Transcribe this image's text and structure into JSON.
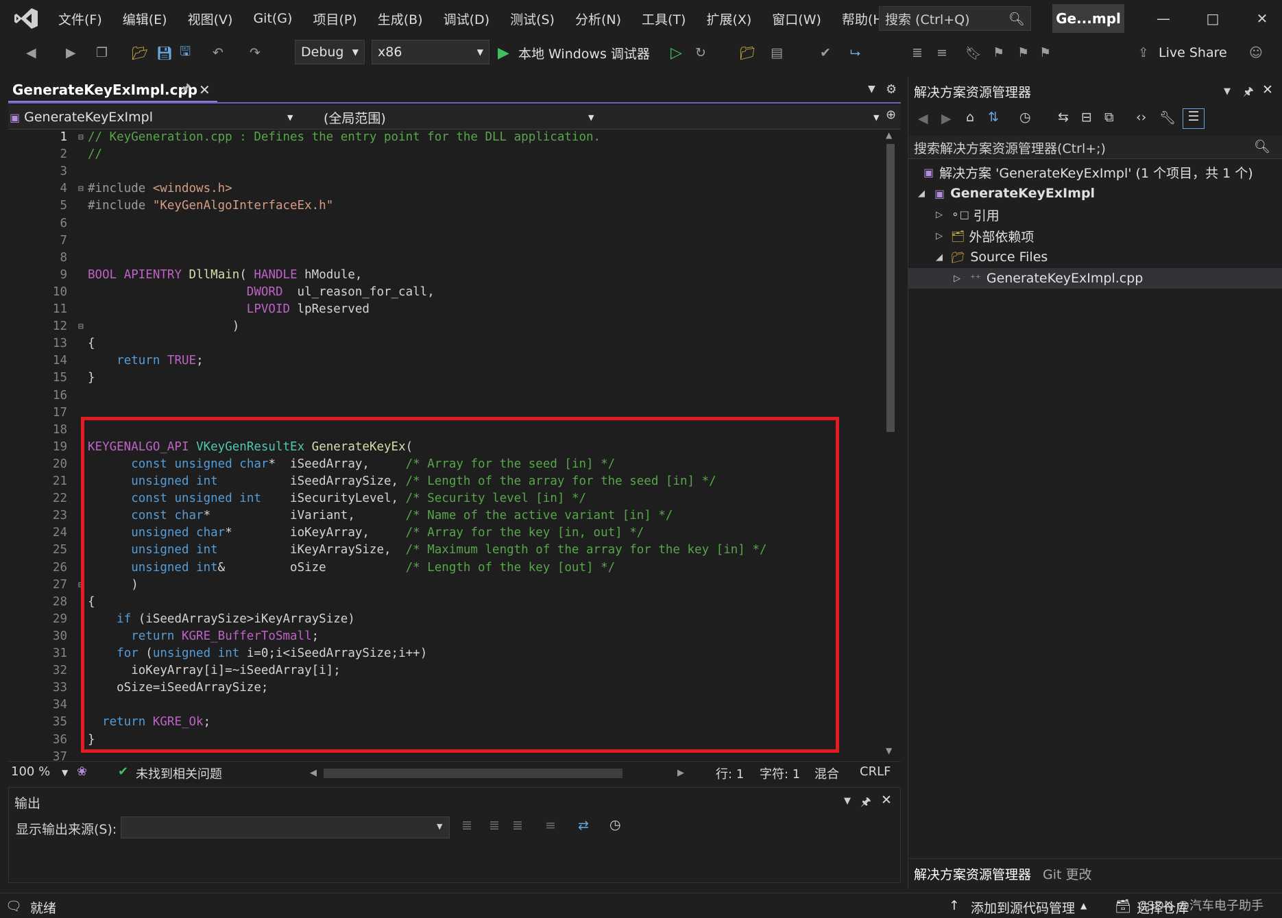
{
  "menubar": {
    "items": [
      "文件(F)",
      "编辑(E)",
      "视图(V)",
      "Git(G)",
      "项目(P)",
      "生成(B)",
      "调试(D)",
      "测试(S)",
      "分析(N)",
      "工具(T)",
      "扩展(X)",
      "窗口(W)",
      "帮助(H)"
    ],
    "search_placeholder": "搜索 (Ctrl+Q)",
    "solution_badge": "Ge...mpl"
  },
  "toolbar": {
    "config": "Debug",
    "platform": "x86",
    "run_label": "本地 Windows 调试器",
    "live_share": "Live Share"
  },
  "editor": {
    "tab_title": "GenerateKeyExImpl.cpp",
    "project_dropdown": "GenerateKeyExImpl",
    "scope_dropdown": "(全局范围)",
    "zoom": "100 %",
    "issues": "未找到相关问题",
    "line": "行: 1",
    "char": "字符: 1",
    "encoding": "混合",
    "eol": "CRLF",
    "code_lines": [
      "// KeyGeneration.cpp : Defines the entry point for the DLL application.",
      "//",
      "",
      "#include <windows.h>",
      "#include \"KeyGenAlgoInterfaceEx.h\"",
      "",
      "",
      "",
      "BOOL APIENTRY DllMain( HANDLE hModule,",
      "                      DWORD  ul_reason_for_call,",
      "                      LPVOID lpReserved",
      "                    )",
      "{",
      "    return TRUE;",
      "}",
      "",
      "",
      "",
      "KEYGENALGO_API VKeyGenResultEx GenerateKeyEx(",
      "      const unsigned char*  iSeedArray,     /* Array for the seed [in] */",
      "      unsigned int          iSeedArraySize, /* Length of the array for the seed [in] */",
      "      const unsigned int    iSecurityLevel, /* Security level [in] */",
      "      const char*           iVariant,       /* Name of the active variant [in] */",
      "      unsigned char*        ioKeyArray,     /* Array for the key [in, out] */",
      "      unsigned int          iKeyArraySize,  /* Maximum length of the array for the key [in] */",
      "      unsigned int&         oSize           /* Length of the key [out] */",
      "      )",
      "{",
      "    if (iSeedArraySize>iKeyArraySize)",
      "      return KGRE_BufferToSmall;",
      "    for (unsigned int i=0;i<iSeedArraySize;i++)",
      "      ioKeyArray[i]=~iSeedArray[i];",
      "    oSize=iSeedArraySize;",
      "",
      "  return KGRE_Ok;",
      "}",
      ""
    ]
  },
  "output": {
    "title": "输出",
    "source_label": "显示输出来源(S):"
  },
  "solution_explorer": {
    "title": "解决方案资源管理器",
    "search_placeholder": "搜索解决方案资源管理器(Ctrl+;)",
    "solution_row": "解决方案 'GenerateKeyExImpl' (1 个项目，共 1 个)",
    "project": "GenerateKeyExImpl",
    "references": "引用",
    "external_deps": "外部依赖项",
    "source_files": "Source Files",
    "selected_file": "GenerateKeyExImpl.cpp",
    "bottom_tabs": [
      "解决方案资源管理器",
      "Git 更改"
    ]
  },
  "statusbar": {
    "ready": "就绪",
    "add_source_control": "添加到源代码管理",
    "select_repo": "选择仓库",
    "watermark": "CSDN @汽车电子助手"
  },
  "colors": {
    "accent_purple": "#6c5fc7",
    "highlight_red": "#e31b23",
    "comment_green": "#57a64a",
    "keyword_blue": "#569cd6"
  }
}
